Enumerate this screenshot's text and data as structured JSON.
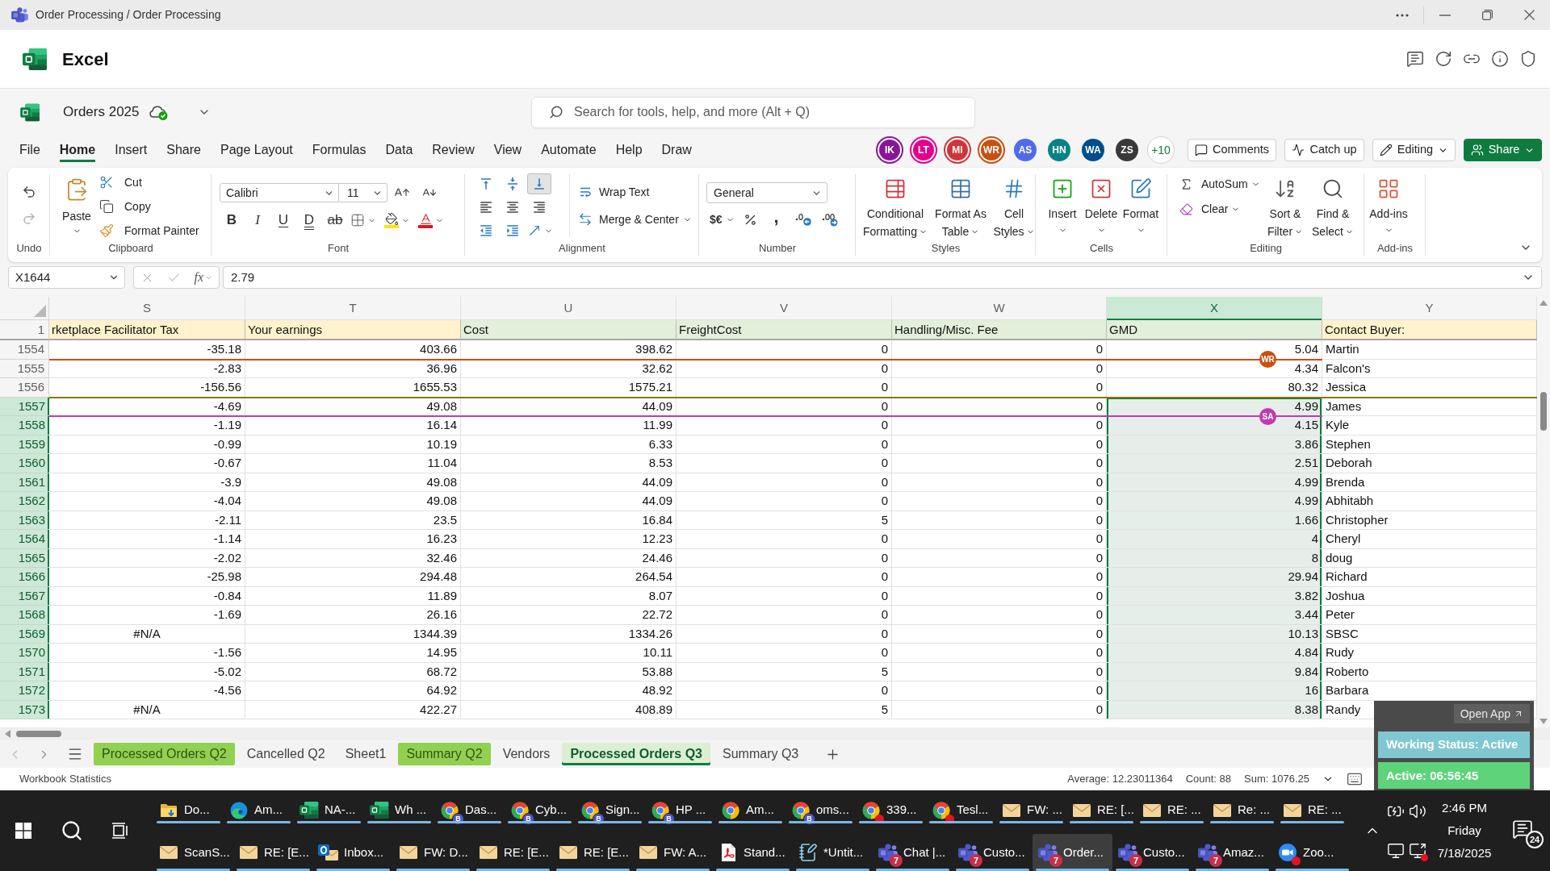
{
  "title_bar": {
    "title": "Order Processing / Order Processing"
  },
  "app_header": {
    "app_name": "Excel"
  },
  "document": {
    "name": "Orders 2025",
    "saved": true
  },
  "search": {
    "placeholder": "Search for tools, help, and more (Alt + Q)"
  },
  "menu_tabs": [
    {
      "label": "File",
      "selected": false
    },
    {
      "label": "Home",
      "selected": true
    },
    {
      "label": "Insert",
      "selected": false
    },
    {
      "label": "Share",
      "selected": false
    },
    {
      "label": "Page Layout",
      "selected": false
    },
    {
      "label": "Formulas",
      "selected": false
    },
    {
      "label": "Data",
      "selected": false
    },
    {
      "label": "Review",
      "selected": false
    },
    {
      "label": "View",
      "selected": false
    },
    {
      "label": "Automate",
      "selected": false
    },
    {
      "label": "Help",
      "selected": false
    },
    {
      "label": "Draw",
      "selected": false
    }
  ],
  "collaborators": [
    {
      "initials": "IK",
      "color": "#881798",
      "active": true
    },
    {
      "initials": "LT",
      "color": "#e3008c",
      "active": true
    },
    {
      "initials": "MI",
      "color": "#d13438",
      "active": true
    },
    {
      "initials": "WR",
      "color": "#ca5010",
      "active": true
    },
    {
      "initials": "AS",
      "color": "#4f6bed",
      "active": false
    },
    {
      "initials": "HN",
      "color": "#038387",
      "active": false
    },
    {
      "initials": "WA",
      "color": "#004e8c",
      "active": false
    },
    {
      "initials": "ZS",
      "color": "#393939",
      "active": false
    }
  ],
  "more_collaborators": "+10",
  "header_buttons": [
    {
      "kind": "comments",
      "label": "Comments"
    },
    {
      "kind": "catchup",
      "label": "Catch up"
    },
    {
      "kind": "editing",
      "label": "Editing"
    },
    {
      "kind": "share",
      "label": "Share"
    }
  ],
  "ribbon": {
    "undo": {
      "label": "Undo",
      "redo_disabled": true
    },
    "clipboard": {
      "label": "Clipboard",
      "paste": "Paste",
      "actions": [
        {
          "kind": "cut",
          "label": "Cut"
        },
        {
          "kind": "copy",
          "label": "Copy"
        },
        {
          "kind": "painter",
          "label": "Format Painter"
        }
      ]
    },
    "font": {
      "label": "Font",
      "font_name": "Calibri",
      "font_size": "11",
      "styles": [
        {
          "kind": "bold",
          "glyph": "B"
        },
        {
          "kind": "italic",
          "glyph": "I"
        },
        {
          "kind": "underline",
          "glyph": "U"
        },
        {
          "kind": "double",
          "glyph": "D"
        },
        {
          "kind": "strike",
          "glyph": "ab"
        }
      ]
    },
    "alignment": {
      "label": "Alignment",
      "vertical": [
        {
          "selected": false
        },
        {
          "selected": false
        },
        {
          "selected": true
        }
      ],
      "wrap": "Wrap Text",
      "merge": "Merge & Center"
    },
    "number": {
      "label": "Number",
      "format": "General",
      "currency": "$€",
      "comma": ","
    },
    "styles": {
      "label": "Styles",
      "buttons": [
        {
          "kind": "conditional",
          "label": "Conditional Formatting"
        },
        {
          "kind": "table",
          "label": "Format As Table"
        },
        {
          "kind": "cellstyles",
          "label": "Cell Styles"
        }
      ]
    },
    "cells": {
      "label": "Cells",
      "buttons": [
        {
          "kind": "insert",
          "label": "Insert"
        },
        {
          "kind": "delete",
          "label": "Delete"
        },
        {
          "kind": "format",
          "label": "Format"
        }
      ]
    },
    "editing": {
      "label": "Editing",
      "autosum": "AutoSum",
      "clear": "Clear",
      "buttons": [
        {
          "kind": "sort",
          "label": "Sort & Filter"
        },
        {
          "kind": "find",
          "label": "Find & Select"
        }
      ]
    },
    "addins": {
      "label": "Add-ins",
      "button": "Add-ins"
    }
  },
  "formula_bar": {
    "name_box": "X1644",
    "function_symbol": "fx",
    "value": "2.79"
  },
  "sheet": {
    "columns": [
      {
        "letter": "S",
        "kind": "number",
        "selected": false
      },
      {
        "letter": "T",
        "kind": "number",
        "selected": false
      },
      {
        "letter": "U",
        "kind": "number",
        "selected": false
      },
      {
        "letter": "V",
        "kind": "number",
        "selected": false
      },
      {
        "letter": "W",
        "kind": "number",
        "selected": false
      },
      {
        "letter": "X",
        "kind": "number",
        "selected": true
      },
      {
        "letter": "Y",
        "kind": "text",
        "selected": false
      }
    ],
    "header_row": {
      "number": "1",
      "cells": [
        {
          "text": "rketplace Facilitator Tax",
          "color": "#fff2cc"
        },
        {
          "text": "Your earnings",
          "color": "#fff2cc"
        },
        {
          "text": "Cost",
          "color": "#e2efda"
        },
        {
          "text": "FreightCost",
          "color": "#e2efda"
        },
        {
          "text": "Handling/Misc. Fee",
          "color": "#e2efda"
        },
        {
          "text": "GMD",
          "color": "#e2efda"
        },
        {
          "text": "Contact Buyer:",
          "color": "#fff2cc"
        }
      ]
    },
    "rows": [
      {
        "number": "1554",
        "selected": false,
        "cells": [
          "-35.18",
          "403.66",
          "398.62",
          "0",
          "0",
          "5.04",
          "Martin"
        ]
      },
      {
        "number": "1555",
        "selected": false,
        "cells": [
          "-2.83",
          "36.96",
          "32.62",
          "0",
          "0",
          "4.34",
          "Falcon's"
        ],
        "cursor": {
          "initials": "WR",
          "color": "#ca5010"
        }
      },
      {
        "number": "1556",
        "selected": false,
        "cells": [
          "-156.56",
          "1655.53",
          "1575.21",
          "0",
          "0",
          "80.32",
          "Jessica"
        ]
      },
      {
        "number": "1557",
        "selected": true,
        "cells": [
          "-4.69",
          "49.08",
          "44.09",
          "0",
          "0",
          "4.99",
          "James"
        ],
        "cursor": {
          "color": "#8a7500"
        }
      },
      {
        "number": "1558",
        "selected": true,
        "cells": [
          "-1.19",
          "16.14",
          "11.99",
          "0",
          "0",
          "4.15",
          "Kyle"
        ],
        "cursor": {
          "initials": "SA",
          "color": "#c239b3"
        }
      },
      {
        "number": "1559",
        "selected": true,
        "cells": [
          "-0.99",
          "10.19",
          "6.33",
          "0",
          "0",
          "3.86",
          "Stephen"
        ]
      },
      {
        "number": "1560",
        "selected": true,
        "cells": [
          "-0.67",
          "11.04",
          "8.53",
          "0",
          "0",
          "2.51",
          "Deborah"
        ]
      },
      {
        "number": "1561",
        "selected": true,
        "cells": [
          "-3.9",
          "49.08",
          "44.09",
          "0",
          "0",
          "4.99",
          "Brenda"
        ]
      },
      {
        "number": "1562",
        "selected": true,
        "cells": [
          "-4.04",
          "49.08",
          "44.09",
          "0",
          "0",
          "4.99",
          "Abhitabh"
        ]
      },
      {
        "number": "1563",
        "selected": true,
        "cells": [
          "-2.11",
          "23.5",
          "16.84",
          "5",
          "0",
          "1.66",
          "Christopher"
        ]
      },
      {
        "number": "1564",
        "selected": true,
        "cells": [
          "-1.14",
          "16.23",
          "12.23",
          "0",
          "0",
          "4",
          "Cheryl"
        ]
      },
      {
        "number": "1565",
        "selected": true,
        "cells": [
          "-2.02",
          "32.46",
          "24.46",
          "0",
          "0",
          "8",
          "doug"
        ]
      },
      {
        "number": "1566",
        "selected": true,
        "cells": [
          "-25.98",
          "294.48",
          "264.54",
          "0",
          "0",
          "29.94",
          "Richard"
        ]
      },
      {
        "number": "1567",
        "selected": true,
        "cells": [
          "-0.84",
          "11.89",
          "8.07",
          "0",
          "0",
          "3.82",
          "Joshua"
        ]
      },
      {
        "number": "1568",
        "selected": true,
        "cells": [
          "-1.69",
          "26.16",
          "22.72",
          "0",
          "0",
          "3.44",
          "Peter"
        ]
      },
      {
        "number": "1569",
        "selected": true,
        "cells": [
          {
            "kind": "error",
            "text": "#N/A"
          },
          "1344.39",
          "1334.26",
          "0",
          "0",
          "10.13",
          "SBSC"
        ]
      },
      {
        "number": "1570",
        "selected": true,
        "cells": [
          "-1.56",
          "14.95",
          "10.11",
          "0",
          "0",
          "4.84",
          "Rudy"
        ]
      },
      {
        "number": "1571",
        "selected": true,
        "cells": [
          "-5.02",
          "68.72",
          "53.88",
          "5",
          "0",
          "9.84",
          "Roberto"
        ]
      },
      {
        "number": "1572",
        "selected": true,
        "cells": [
          "-4.56",
          "64.92",
          "48.92",
          "0",
          "0",
          "16",
          "Barbara"
        ]
      },
      {
        "number": "1573",
        "selected": true,
        "cells": [
          {
            "kind": "error",
            "text": "#N/A"
          },
          "422.27",
          "408.89",
          "5",
          "0",
          "8.38",
          "Randy"
        ]
      }
    ]
  },
  "sheet_tabs": [
    {
      "label": "Processed Orders Q2",
      "selected": false,
      "color": "#92d050"
    },
    {
      "label": "Cancelled Q2",
      "selected": false
    },
    {
      "label": "Sheet1",
      "selected": false
    },
    {
      "label": "Summary Q2",
      "selected": false,
      "color": "#92d050"
    },
    {
      "label": "Vendors",
      "selected": false
    },
    {
      "label": "Processed Orders Q3",
      "selected": true,
      "color": "#dcefd3"
    },
    {
      "label": "Summary Q3",
      "selected": false
    }
  ],
  "status_bar": {
    "label": "Workbook Statistics",
    "stats": [
      "Average: 12.23011364",
      "Count: 88",
      "Sum: 1076.25"
    ]
  },
  "status_widget": {
    "open_app": "Open App",
    "status": "Working Status: Active",
    "timer": "Active: 06:56:45"
  },
  "taskbar": {
    "upper_buttons": [
      {
        "label": "Do...",
        "kind": "folder",
        "dot": false,
        "selected": false
      },
      {
        "label": "Am...",
        "kind": "edge",
        "dot": false,
        "selected": false
      },
      {
        "label": "NA-...",
        "kind": "excel",
        "dot": false,
        "selected": false
      },
      {
        "label": "Wh ...",
        "kind": "excel",
        "dot": false,
        "selected": false
      },
      {
        "label": "Das...",
        "kind": "chrome",
        "badge": "B",
        "dot": false,
        "selected": false
      },
      {
        "label": "Cyb...",
        "kind": "chrome",
        "badge": "B",
        "dot": false,
        "selected": false
      },
      {
        "label": "Sign...",
        "kind": "chrome",
        "badge": "B",
        "dot": false,
        "selected": false
      },
      {
        "label": "HP ...",
        "kind": "chrome",
        "badge": "B",
        "dot": false,
        "selected": false
      },
      {
        "label": "Am...",
        "kind": "chrome",
        "dot": false,
        "selected": false
      },
      {
        "label": "oms...",
        "kind": "chrome",
        "badge": "B",
        "dot": false,
        "selected": false
      },
      {
        "label": "339...",
        "kind": "chrome",
        "dot": true,
        "selected": false
      },
      {
        "label": "Tesl...",
        "kind": "chrome",
        "dot": true,
        "selected": false
      },
      {
        "label": "FW: ...",
        "kind": "mail",
        "dot": false,
        "selected": false
      },
      {
        "label": "RE: [...",
        "kind": "mail",
        "dot": false,
        "selected": false
      },
      {
        "label": "RE: ...",
        "kind": "mail",
        "dot": false,
        "selected": false
      },
      {
        "label": "Re: ...",
        "kind": "mail",
        "dot": false,
        "selected": false
      },
      {
        "label": "RE: ...",
        "kind": "mail",
        "dot": false,
        "selected": false
      }
    ],
    "lower_buttons": [
      {
        "label": "ScanS...",
        "kind": "mail",
        "dot": false,
        "selected": false
      },
      {
        "label": "RE: [E...",
        "kind": "mail",
        "dot": false,
        "selected": false
      },
      {
        "label": "Inbox...",
        "kind": "outlook",
        "dot": false,
        "selected": false
      },
      {
        "label": "FW: D...",
        "kind": "mail",
        "dot": false,
        "selected": false
      },
      {
        "label": "RE: [E...",
        "kind": "mail",
        "dot": false,
        "selected": false
      },
      {
        "label": "RE: [E...",
        "kind": "mail",
        "dot": false,
        "selected": false
      },
      {
        "label": "FW: A...",
        "kind": "mail",
        "dot": false,
        "selected": false
      },
      {
        "label": "Stand...",
        "kind": "pdf",
        "dot": false,
        "selected": false
      },
      {
        "label": "*Untit...",
        "kind": "notepad",
        "dot": false,
        "selected": false
      },
      {
        "label": "Chat |...",
        "kind": "teams",
        "badge": "7",
        "dot": false,
        "selected": false
      },
      {
        "label": "Custo...",
        "kind": "teams",
        "badge": "7",
        "dot": false,
        "selected": false
      },
      {
        "label": "Order...",
        "kind": "teams",
        "badge": "7",
        "dot": false,
        "selected": true
      },
      {
        "label": "Custo...",
        "kind": "teams",
        "badge": "7",
        "dot": false,
        "selected": false
      },
      {
        "label": "Amaz...",
        "kind": "teams",
        "badge": "7",
        "dot": false,
        "selected": false
      },
      {
        "label": "Zoo...",
        "kind": "zoom",
        "dot": true,
        "selected": false
      }
    ],
    "tray": {
      "time": "2:46 PM",
      "day": "Friday",
      "date": "7/18/2025",
      "notifications": "24"
    }
  }
}
